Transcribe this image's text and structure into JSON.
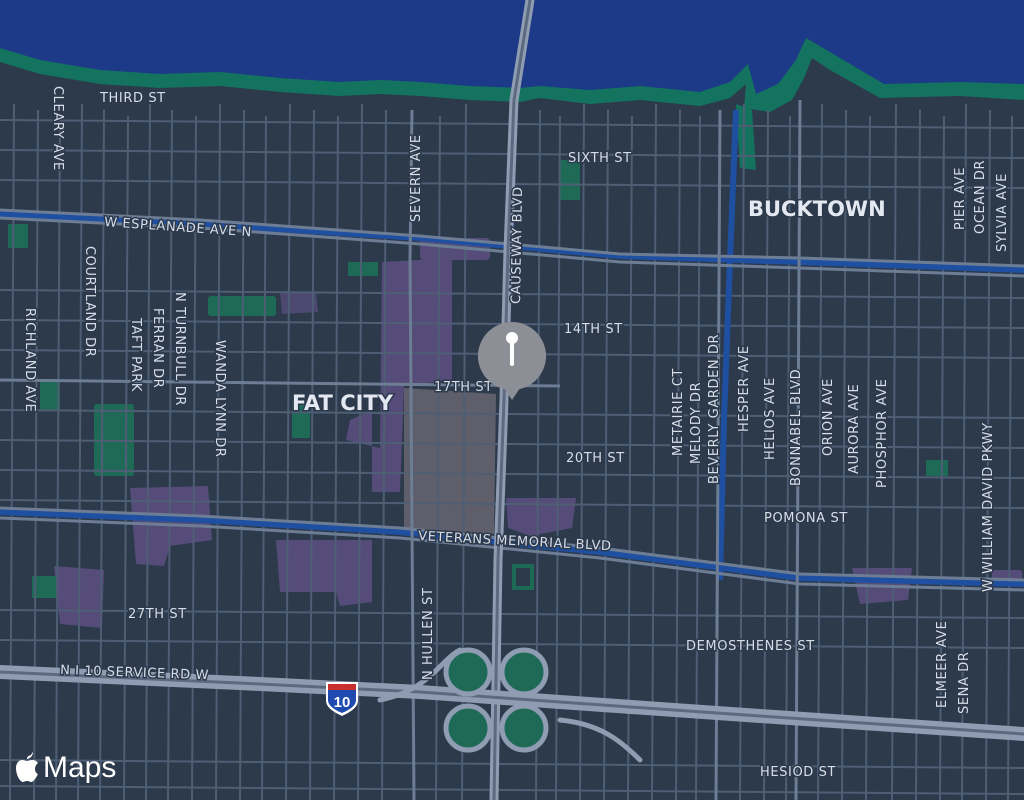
{
  "map": {
    "areas": {
      "fat_city": "FAT CITY",
      "bucktown": "BUCKTOWN"
    },
    "streets": {
      "third": "THIRD ST",
      "cleary": "CLEARY AVE",
      "severn": "SEVERN AVE",
      "causeway": "CAUSEWAY BLVD",
      "sixth": "SIXTH ST",
      "esplanade": "W ESPLANADE AVE N",
      "courtland": "COURTLAND DR",
      "richland": "RICHLAND AVE",
      "n_turnbull": "N TURNBULL DR",
      "ferran": "FERRAN DR",
      "taft": "TAFT PARK",
      "wanda_lynn": "WANDA LYNN DR",
      "fourteenth": "14TH ST",
      "seventeenth": "17TH ST",
      "twentieth": "20TH ST",
      "pomona": "POMONA ST",
      "veterans": "VETERANS MEMORIAL BLVD",
      "metairie_ct": "METAIRIE CT",
      "melody": "MELODY DR",
      "beverly_garden": "BEVERLY GARDEN DR",
      "hesper": "HESPER AVE",
      "helios": "HELIOS AVE",
      "bonnabel": "BONNABEL BLVD",
      "orion": "ORION AVE",
      "aurora": "AURORA AVE",
      "phosphor": "PHOSPHOR AVE",
      "w_william_david": "W WILLIAM DAVID PKWY",
      "sylvia": "SYLVIA AVE",
      "ocean": "OCEAN DR",
      "pier": "PIER AVE",
      "twentyseventh": "27TH ST",
      "n_hullen": "N HULLEN ST",
      "demosthenes": "DEMOSTHENES ST",
      "n_i10_service": "N I 10 SERVICE RD W",
      "elmeer": "ELMEER AVE",
      "sena": "SENA DR",
      "hesiod": "HESIOD ST"
    },
    "shield": {
      "label": "10",
      "type": "interstate-shield"
    },
    "pin": {
      "icon": "map-pin-icon"
    },
    "attribution": {
      "label": "Maps",
      "icon": "apple-logo-icon"
    }
  },
  "colors": {
    "land": "#2c3a4c",
    "water": "#1c3a88",
    "shore": "#137060",
    "road": "#4e5e74",
    "highway": "#8f9cb1",
    "canal": "#1f4fa0",
    "park": "#1e6a57",
    "commercial": "#554c79",
    "pin": "#8c8f96"
  }
}
